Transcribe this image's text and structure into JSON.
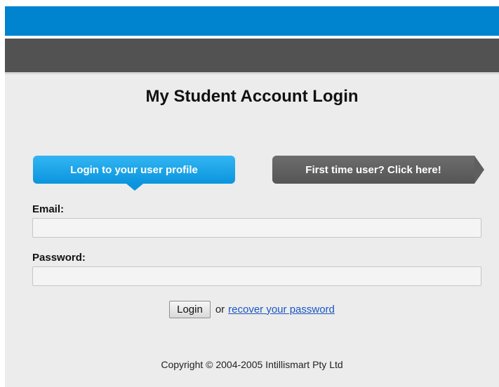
{
  "page_title": "My Student Account Login",
  "tabs": {
    "login_label": "Login to your user profile",
    "first_time_label": "First time user? Click here!"
  },
  "form": {
    "email_label": "Email:",
    "email_value": "",
    "password_label": "Password:",
    "password_value": "",
    "login_button": "Login",
    "or_text": "or",
    "recover_link": "recover your password"
  },
  "footer": {
    "copyright": "Copyright © 2004-2005 Intillismart Pty Ltd"
  },
  "colors": {
    "header_blue": "#0184cf",
    "header_gray": "#525252",
    "tab_active": "#0a95de",
    "tab_inactive": "#5f5f5f",
    "link": "#1a57c2"
  }
}
